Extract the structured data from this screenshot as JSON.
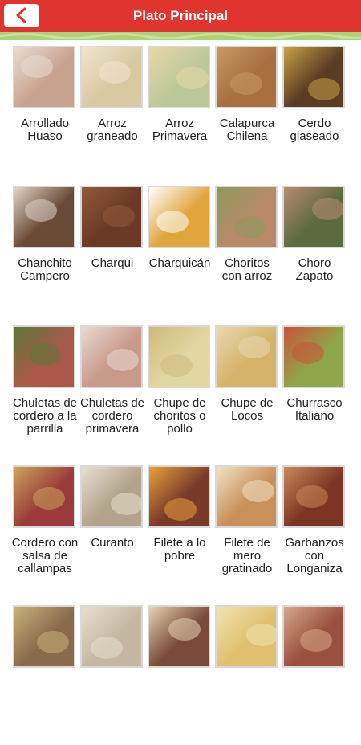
{
  "header": {
    "title": "Plato Principal",
    "back_icon": "chevron-left-icon",
    "color": "#e0342f",
    "strip_color": "#a9d27b"
  },
  "dishes": [
    {
      "label": "Arrollado Huaso",
      "tone": "#c9a38e",
      "accent": "#eadbd2"
    },
    {
      "label": "Arroz graneado",
      "tone": "#d9c9a3",
      "accent": "#f0e6cf"
    },
    {
      "label": "Arroz Primavera",
      "tone": "#bdc89a",
      "accent": "#e8d9a8"
    },
    {
      "label": "Calapurca Chilena",
      "tone": "#a86f3f",
      "accent": "#c79a63"
    },
    {
      "label": "Cerdo glaseado",
      "tone": "#5a3b24",
      "accent": "#c8a144"
    },
    {
      "label": "Chanchito Campero",
      "tone": "#6b4a35",
      "accent": "#ddd4c8"
    },
    {
      "label": "Charqui",
      "tone": "#6a3a26",
      "accent": "#8f5a3c"
    },
    {
      "label": "Charquicán",
      "tone": "#e0a53c",
      "accent": "#ffffff"
    },
    {
      "label": "Choritos con arroz",
      "tone": "#b98a6a",
      "accent": "#8a9a5a"
    },
    {
      "label": "Choro Zapato",
      "tone": "#5c6b3f",
      "accent": "#b88a73"
    },
    {
      "label": "Chuletas de cordero a la parrilla",
      "tone": "#a9584a",
      "accent": "#5b7a3a"
    },
    {
      "label": "Chuletas de cordero primavera",
      "tone": "#c89a8a",
      "accent": "#ead9d2"
    },
    {
      "label": "Chupe de choritos o pollo",
      "tone": "#e2d6a3",
      "accent": "#cfb97a"
    },
    {
      "label": "Chupe de Locos",
      "tone": "#d6b36a",
      "accent": "#e8d9b0"
    },
    {
      "label": "Churrasco Italiano",
      "tone": "#8fa64a",
      "accent": "#c9523a"
    },
    {
      "label": "Cordero con salsa de callampas",
      "tone": "#9a3a3a",
      "accent": "#c9a45a"
    },
    {
      "label": "Curanto",
      "tone": "#b2a48a",
      "accent": "#e6e0d2"
    },
    {
      "label": "Filete a lo pobre",
      "tone": "#7a3a2a",
      "accent": "#e8a03a"
    },
    {
      "label": "Filete de mero gratinado",
      "tone": "#c9905a",
      "accent": "#f1e2c6"
    },
    {
      "label": "Garbanzos con Longaniza",
      "tone": "#7e3424",
      "accent": "#c98a5a"
    },
    {
      "label": "",
      "tone": "#8a6a4a",
      "accent": "#c9b07a"
    },
    {
      "label": "",
      "tone": "#c4b8a0",
      "accent": "#e8e0cc"
    },
    {
      "label": "",
      "tone": "#7a4a3a",
      "accent": "#e6d3b0"
    },
    {
      "label": "",
      "tone": "#e0c070",
      "accent": "#f3e3b0"
    },
    {
      "label": "",
      "tone": "#9a5040",
      "accent": "#d9a888"
    }
  ]
}
